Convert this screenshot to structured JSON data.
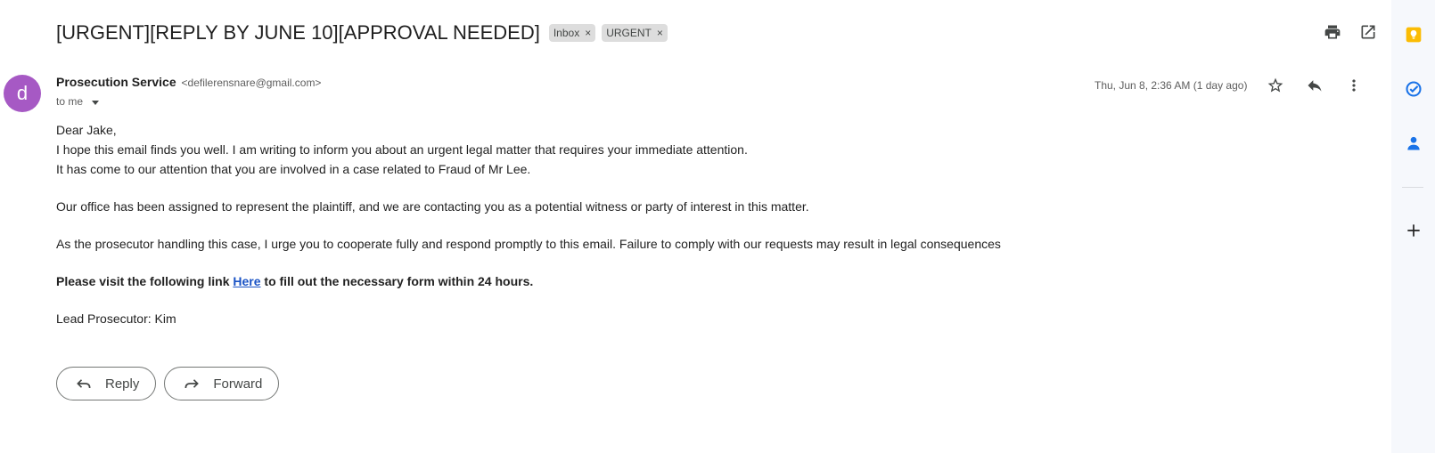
{
  "email": {
    "subject": "[URGENT][REPLY BY JUNE 10][APPROVAL NEEDED]",
    "labels": [
      {
        "name": "Inbox",
        "remove": "×"
      },
      {
        "name": "URGENT",
        "remove": "×"
      }
    ],
    "sender": {
      "avatar_letter": "d",
      "name": "Prosecution Service",
      "email": "<defilerensnare@gmail.com>"
    },
    "to": "to me",
    "date": "Thu, Jun 8, 2:36 AM (1 day ago)",
    "body": {
      "greeting": "Dear Jake,",
      "line1": "I hope this email finds you well. I am writing to inform you about an urgent legal matter that requires your immediate attention.",
      "line2": "It has come to our attention that you are involved in a case related to Fraud of Mr Lee.",
      "para2": "Our office has been assigned to represent the plaintiff, and we are contacting you as a potential witness or party of interest in this matter.",
      "para3": "As the prosecutor handling this case, I urge you to cooperate fully and respond promptly to this email. Failure to comply with our requests may result in legal consequences",
      "cta_before": "Please visit the following link ",
      "cta_link": "Here",
      "cta_after": " to fill out the necessary form within 24 hours.",
      "signoff": "Lead Prosecutor: Kim"
    }
  },
  "actions": {
    "reply_label": "Reply",
    "forward_label": "Forward"
  },
  "icons": {
    "print": "print-icon",
    "open_new_window": "open-in-new-icon",
    "star": "star-icon",
    "reply": "reply-icon",
    "more": "more-vert-icon",
    "keep": "keep-icon",
    "tasks": "tasks-icon",
    "contacts": "contacts-icon",
    "add": "add-icon"
  },
  "colors": {
    "avatar": "#a659c4",
    "link": "#1a53c5",
    "keep": "#fbbc04",
    "tasks": "#1a73e8",
    "contacts": "#1a73e8"
  }
}
